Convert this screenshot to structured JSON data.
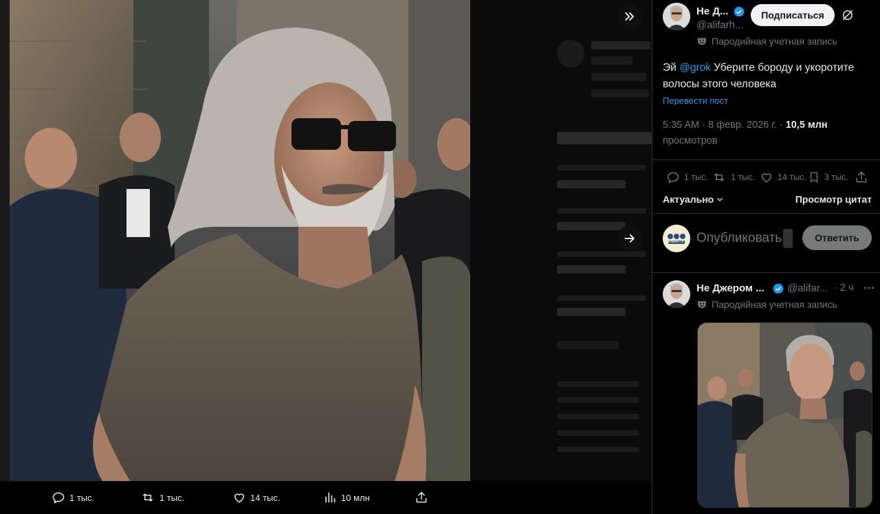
{
  "media_viewer": {
    "actions": {
      "replies": "1 тыс.",
      "reposts": "1 тыс.",
      "likes": "14 тыс.",
      "views": "10 млн"
    }
  },
  "post": {
    "author_name": "Не Д...",
    "author_handle": "@alifarh...",
    "parody_label": "Пародийная учетная запись",
    "follow_label": "Подписаться",
    "text_before": "Эй ",
    "mention": "@grok",
    "text_after": " Уберите бороду и укоротите волосы этого человека",
    "translate_label": "Перевести пост",
    "timestamp": "5:35 AM · 8 февр. 2026 г. · ",
    "views_count": "10,5 млн",
    "views_word": "просмотров",
    "stats": {
      "replies": "1 тыс.",
      "reposts": "1 тыс.",
      "likes": "14 тыс.",
      "bookmarks": "3 тыс."
    }
  },
  "replies_header": {
    "sort_label": "Актуально",
    "quotes_label": "Просмотр цитат"
  },
  "composer": {
    "placeholder": "Опубликовать",
    "avatar_text": "VideoTV",
    "reply_button": "Ответить"
  },
  "reply": {
    "author_name": "Не Джером ...",
    "author_handle": "@alifar...",
    "time": "· 2 ч",
    "parody_label": "Пародийная учетная запись"
  },
  "colors": {
    "accent": "#1d9bf0",
    "verified": "#1d9bf0",
    "muted_text": "#71767b",
    "border": "#2f3336"
  },
  "icons": [
    "collapse-icon",
    "next-arrow-icon",
    "reply-icon",
    "repost-icon",
    "like-icon",
    "views-icon",
    "share-icon",
    "verified-icon",
    "parody-mask-icon",
    "grok-icon",
    "bookmark-icon",
    "more-icon",
    "chevron-down-icon"
  ]
}
